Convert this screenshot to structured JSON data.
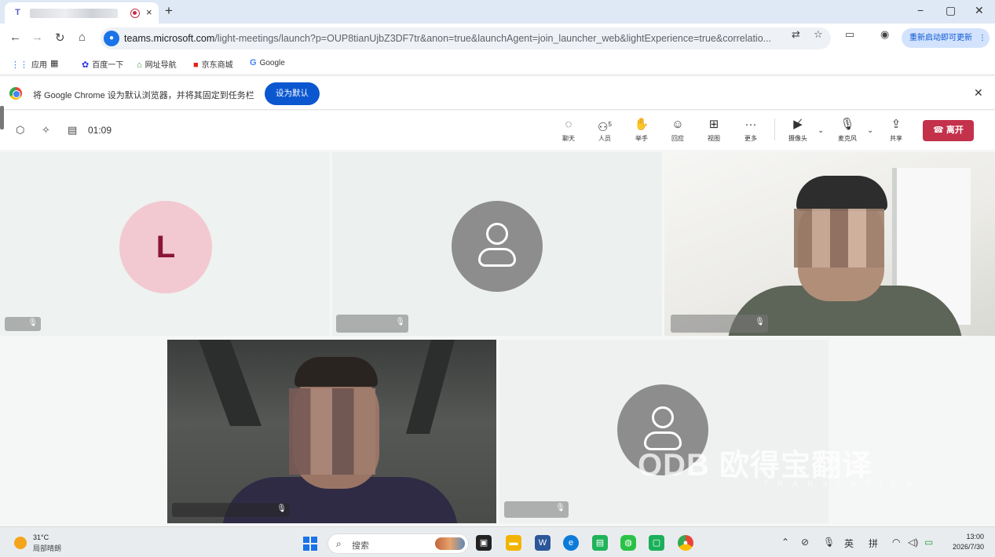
{
  "browser": {
    "tab": {
      "close": "×"
    },
    "new_tab": "+",
    "window_controls": {
      "minimize": "−",
      "maximize": "▢",
      "close": "✕"
    },
    "url_host": "teams.microsoft.com",
    "url_path": "/light-meetings/launch?p=OUP8tianUjbZ3DF7tr&anon=true&launchAgent=join_launcher_web&lightExperience=true&correlatio...",
    "update_button": "重新启动即可更新",
    "bookmarks": [
      {
        "icon": "apps-icon",
        "label": "应用"
      },
      {
        "icon": "grid-icon",
        "label": ""
      },
      {
        "icon": "baidu-icon",
        "label": "百度一下"
      },
      {
        "icon": "nav-icon",
        "label": "网址导航"
      },
      {
        "icon": "jd-icon",
        "label": "京东商城"
      },
      {
        "icon": "google-icon",
        "label": "Google"
      }
    ],
    "infobar": {
      "message": "将 Google Chrome 设为默认浏览器，并将其固定到任务栏",
      "button": "设为默认"
    }
  },
  "meeting": {
    "timer": "01:09",
    "tools": [
      {
        "name": "chat",
        "icon": "chat-icon",
        "label": "聊天"
      },
      {
        "name": "people",
        "icon": "people-icon",
        "label": "人员",
        "count": "5"
      },
      {
        "name": "raise-hand",
        "icon": "hand-icon",
        "label": "举手"
      },
      {
        "name": "react",
        "icon": "emoji-icon",
        "label": "回应"
      },
      {
        "name": "view",
        "icon": "view-icon",
        "label": "视图"
      },
      {
        "name": "more",
        "icon": "more-icon",
        "label": "更多"
      },
      {
        "name": "camera",
        "icon": "camera-off-icon",
        "label": "摄像头"
      },
      {
        "name": "mic",
        "icon": "mic-icon",
        "label": "麦克风"
      },
      {
        "name": "share",
        "icon": "share-icon",
        "label": "共享"
      }
    ],
    "leave_button": "离开",
    "participants": [
      {
        "avatar_letter": "L",
        "avatar_color": "#f2c9d1"
      },
      {
        "avatar_letter": ""
      },
      {
        "video": true
      },
      {
        "video": true
      },
      {
        "avatar_letter": ""
      }
    ]
  },
  "watermark": {
    "logo": "ODB",
    "text": "欧得宝翻译",
    "sub": "TRANSLATION"
  },
  "taskbar": {
    "weather_temp": "31°C",
    "weather_desc": "局部晴朗",
    "search_placeholder": "搜索",
    "tray_lang": "英",
    "tray_ime": "拼",
    "time": "13:00",
    "date": "2026/7/30"
  },
  "colors": {
    "leave": "#c4314b",
    "accent": "#0b57d0",
    "teams": "#5b5fc7"
  }
}
